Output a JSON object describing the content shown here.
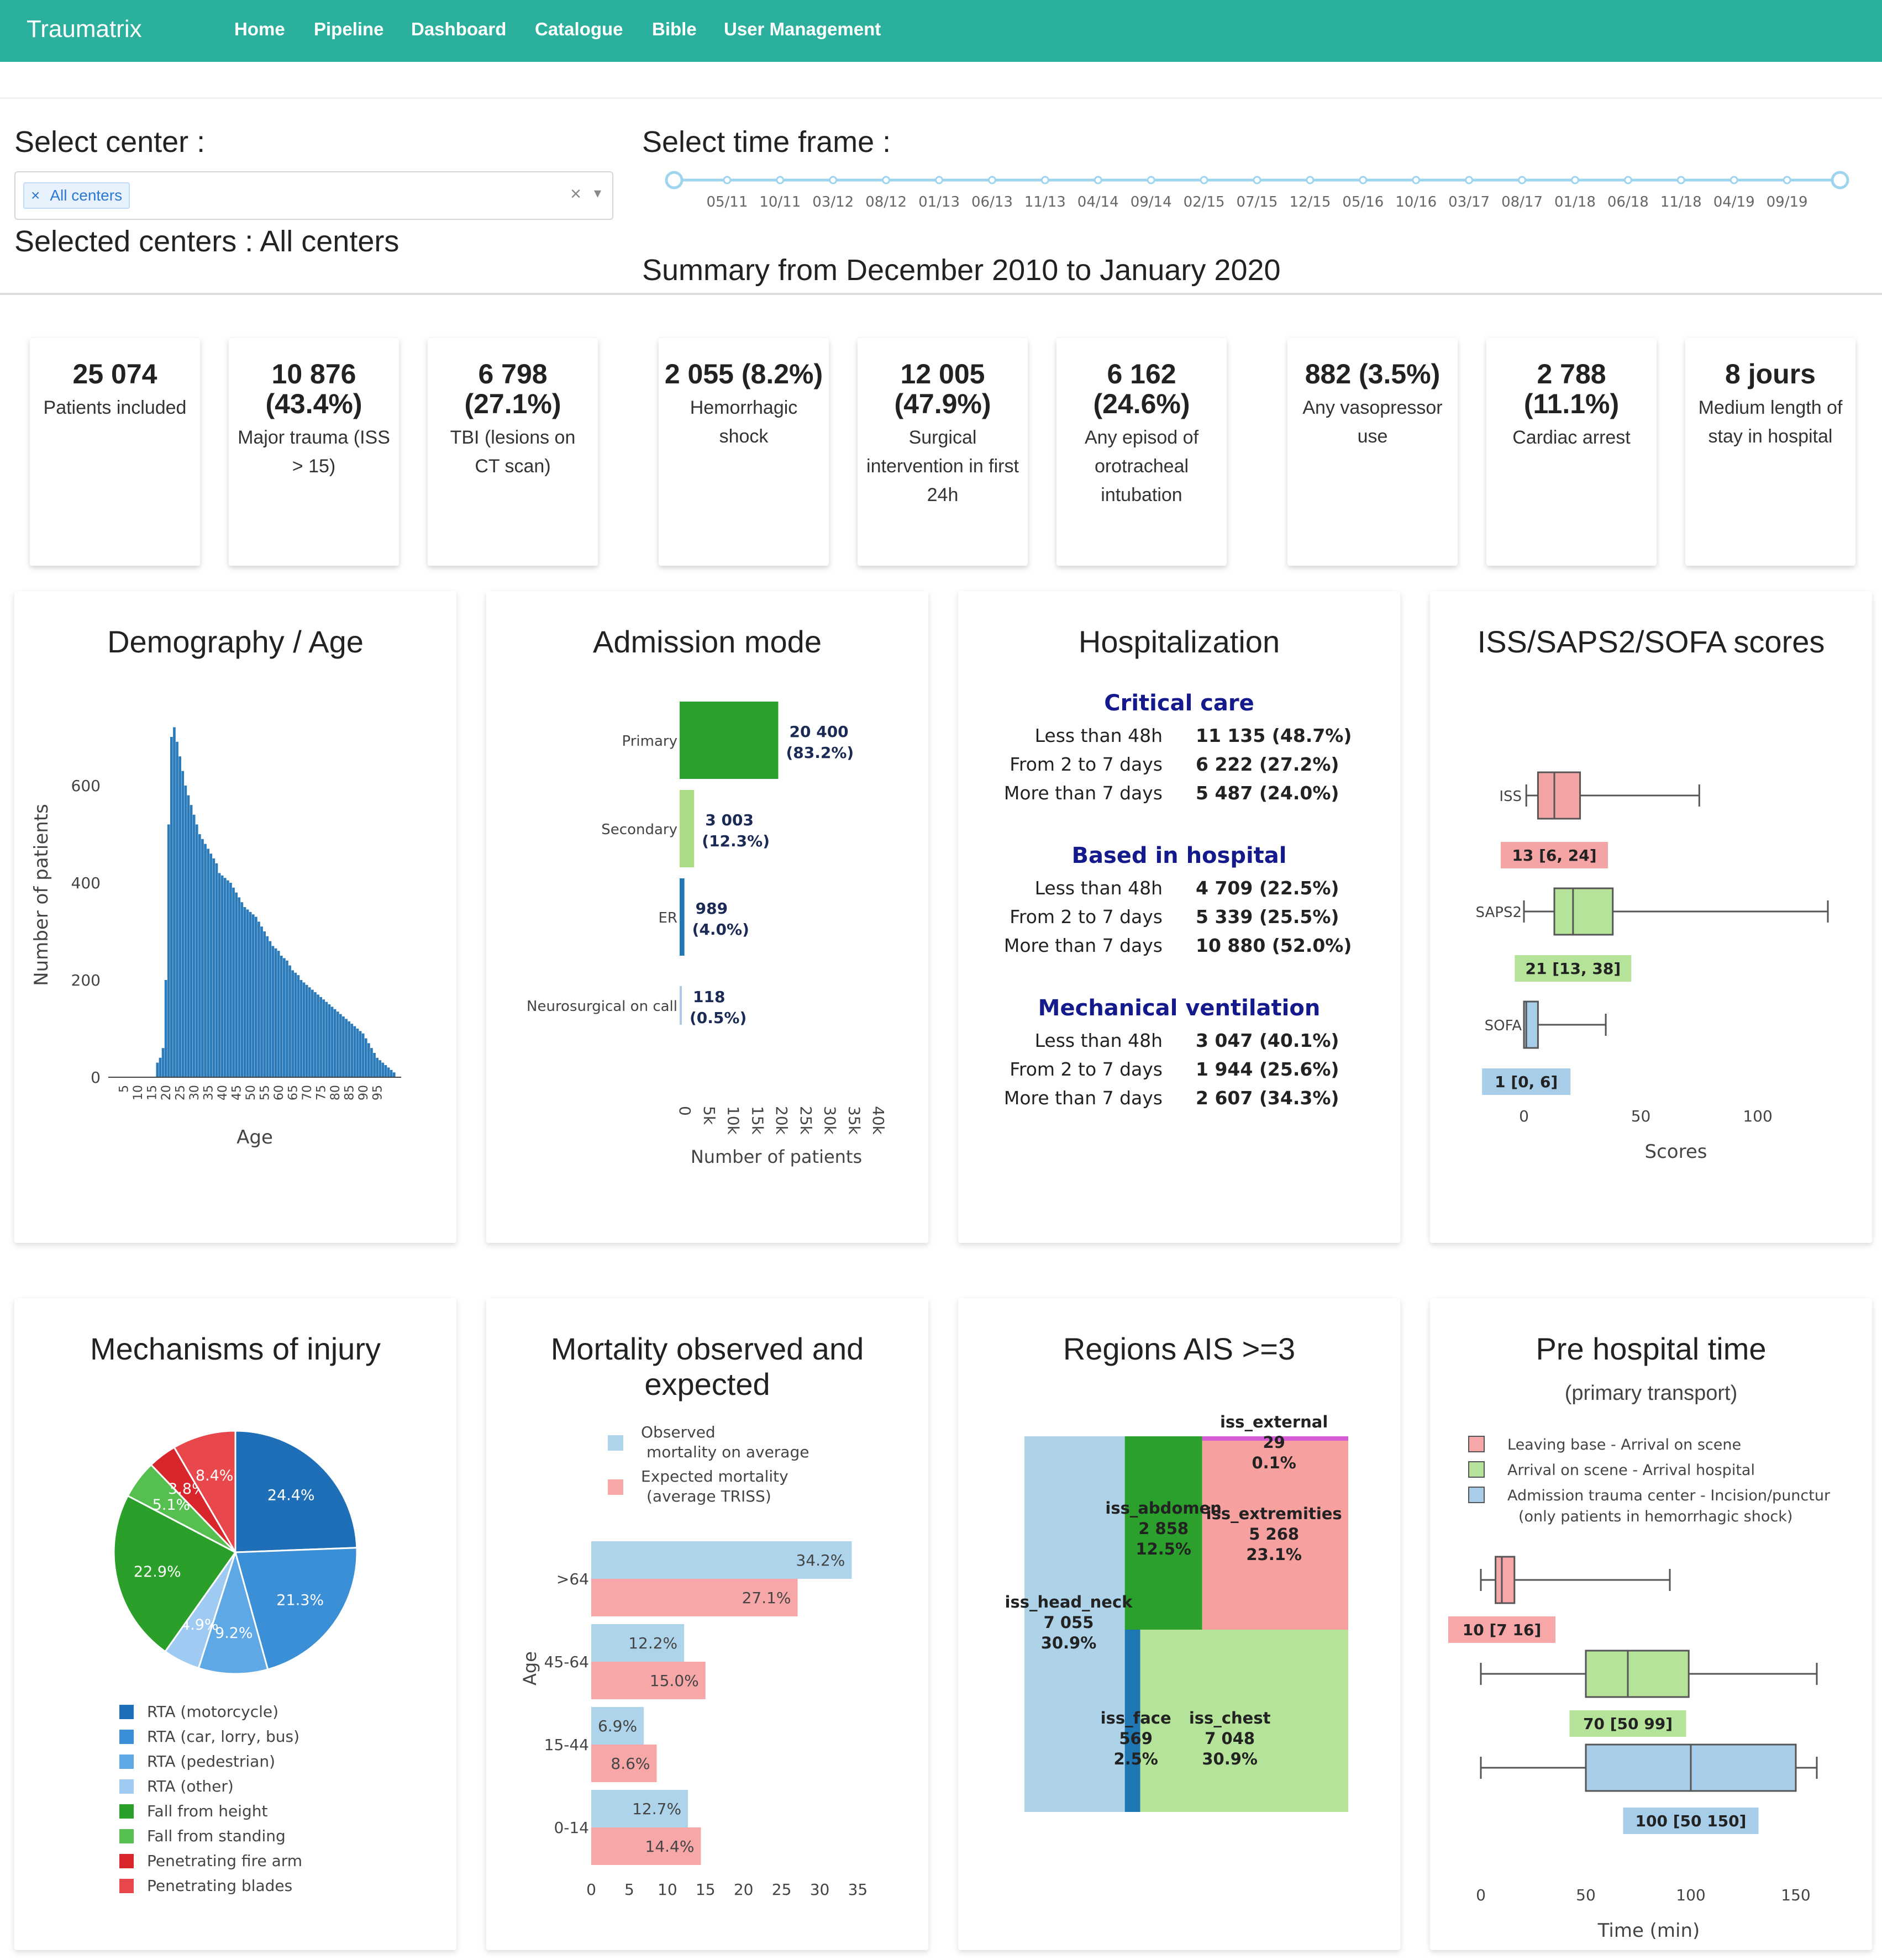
{
  "navbar": {
    "brand": "Traumatrix",
    "items": [
      "Home",
      "Pipeline",
      "Dashboard",
      "Catalogue",
      "Bible",
      "User Management"
    ]
  },
  "filters": {
    "center_label": "Select center :",
    "center_tag": "All centers",
    "clear_icon": "×",
    "dropdown_icon": "chevron-down-icon",
    "selected_text": "Selected centers : All centers",
    "time_label": "Select time frame :",
    "time_ticks": [
      "05/11",
      "10/11",
      "03/12",
      "08/12",
      "01/13",
      "06/13",
      "11/13",
      "04/14",
      "09/14",
      "02/15",
      "07/15",
      "12/15",
      "05/16",
      "10/16",
      "03/17",
      "08/17",
      "01/18",
      "06/18",
      "11/18",
      "04/19",
      "09/19"
    ],
    "summary": "Summary from December 2010 to January 2020"
  },
  "stats": [
    {
      "value": "25 074",
      "label": "Patients included"
    },
    {
      "value": "10 876 (43.4%)",
      "label": "Major trauma (ISS > 15)"
    },
    {
      "value": "6 798 (27.1%)",
      "label": "TBI (lesions on CT scan)"
    },
    {
      "value": "2 055 (8.2%)",
      "label": "Hemorrhagic shock"
    },
    {
      "value": "12 005 (47.9%)",
      "label": "Surgical intervention in first 24h"
    },
    {
      "value": "6 162 (24.6%)",
      "label": "Any episod of orotracheal intubation"
    },
    {
      "value": "882 (3.5%)",
      "label": "Any vasopressor use"
    },
    {
      "value": "2 788 (11.1%)",
      "label": "Cardiac arrest"
    },
    {
      "value": "8 jours",
      "label": "Medium length of stay in hospital"
    }
  ],
  "panels": {
    "demography": {
      "title": "Demography / Age"
    },
    "admission": {
      "title": "Admission mode"
    },
    "hospitalization": {
      "title": "Hospitalization",
      "sections": [
        {
          "heading": "Critical care",
          "rows": [
            [
              "Less than 48h",
              "11 135 (48.7%)"
            ],
            [
              "From 2 to 7 days",
              "6 222 (27.2%)"
            ],
            [
              "More than 7 days",
              "5 487 (24.0%)"
            ]
          ]
        },
        {
          "heading": "Based in hospital",
          "rows": [
            [
              "Less than 48h",
              "4 709 (22.5%)"
            ],
            [
              "From 2 to 7 days",
              "5 339 (25.5%)"
            ],
            [
              "More than 7 days",
              "10 880 (52.0%)"
            ]
          ]
        },
        {
          "heading": "Mechanical ventilation",
          "rows": [
            [
              "Less than 48h",
              "3 047 (40.1%)"
            ],
            [
              "From 2 to 7 days",
              "1 944 (25.6%)"
            ],
            [
              "More than 7 days",
              "2 607 (34.3%)"
            ]
          ]
        }
      ]
    },
    "scores": {
      "title": "ISS/SAPS2/SOFA scores"
    },
    "mechanisms": {
      "title": "Mechanisms of injury"
    },
    "mortality": {
      "title": "Mortality observed and expected"
    },
    "regions": {
      "title": "Regions AIS >=3"
    },
    "prehospital": {
      "title": "Pre hospital time",
      "subtitle": "(primary transport)"
    }
  },
  "chart_data": [
    {
      "type": "bar",
      "name": "age_histogram",
      "xlabel": "Age",
      "ylabel": "Number of patients",
      "yticks": [
        0,
        200,
        400,
        600
      ],
      "ylim": [
        0,
        750
      ],
      "x": [
        15,
        16,
        17,
        18,
        19,
        20,
        21,
        22,
        23,
        24,
        25,
        26,
        27,
        28,
        29,
        30,
        31,
        32,
        33,
        34,
        35,
        36,
        37,
        38,
        39,
        40,
        41,
        42,
        43,
        44,
        45,
        46,
        47,
        48,
        49,
        50,
        51,
        52,
        53,
        54,
        55,
        56,
        57,
        58,
        59,
        60,
        61,
        62,
        63,
        64,
        65,
        66,
        67,
        68,
        69,
        70,
        71,
        72,
        73,
        74,
        75,
        76,
        77,
        78,
        79,
        80,
        81,
        82,
        83,
        84,
        85,
        86,
        87,
        88,
        89,
        90,
        91,
        92,
        93,
        94,
        95,
        96,
        97,
        98,
        99
      ],
      "values": [
        30,
        40,
        60,
        200,
        520,
        700,
        720,
        690,
        660,
        630,
        600,
        580,
        560,
        540,
        520,
        500,
        490,
        480,
        470,
        460,
        450,
        440,
        420,
        415,
        410,
        405,
        400,
        390,
        380,
        370,
        360,
        350,
        345,
        340,
        335,
        330,
        320,
        310,
        300,
        290,
        280,
        270,
        265,
        260,
        250,
        245,
        240,
        230,
        220,
        215,
        210,
        200,
        195,
        190,
        185,
        180,
        175,
        170,
        165,
        160,
        155,
        150,
        145,
        140,
        135,
        130,
        125,
        120,
        115,
        110,
        105,
        100,
        95,
        90,
        80,
        70,
        60,
        50,
        40,
        35,
        30,
        25,
        20,
        15,
        10
      ]
    },
    {
      "type": "bar",
      "name": "admission_mode",
      "orientation": "horizontal",
      "categories": [
        "Primary",
        "Secondary",
        "ER",
        "Neurosurgical on call"
      ],
      "values": [
        20400,
        3003,
        989,
        118
      ],
      "labels": [
        "20 400 (83.2%)",
        "3 003 (12.3%)",
        "989 (4.0%)",
        "118 (0.5%)"
      ],
      "colors": [
        "#2ca02c",
        "#a9dc84",
        "#1f77b4",
        "#aec7e8"
      ],
      "xlabel": "Number of patients",
      "xticks": [
        "0",
        "5k",
        "10k",
        "15k",
        "20k",
        "25k",
        "30k",
        "35k",
        "40k"
      ],
      "xlim": [
        0,
        40000
      ]
    },
    {
      "type": "box",
      "name": "scores",
      "xlabel": "Scores",
      "xticks": [
        0,
        50,
        100
      ],
      "xlim": [
        0,
        130
      ],
      "series": [
        {
          "name": "ISS",
          "q1": 6,
          "median": 13,
          "q3": 24,
          "whisker_low": 1,
          "whisker_high": 75,
          "label": "13 [6, 24]",
          "color": "#f4a4a4"
        },
        {
          "name": "SAPS2",
          "q1": 13,
          "median": 21,
          "q3": 38,
          "whisker_low": 0,
          "whisker_high": 130,
          "label": "21 [13, 38]",
          "color": "#b5e39a"
        },
        {
          "name": "SOFA",
          "q1": 0,
          "median": 1,
          "q3": 6,
          "whisker_low": 0,
          "whisker_high": 35,
          "label": "1 [0, 6]",
          "color": "#a8cde8"
        }
      ]
    },
    {
      "type": "pie",
      "name": "mechanisms",
      "categories": [
        "RTA (motorcycle)",
        "RTA (car, lorry, bus)",
        "RTA (pedestrian)",
        "RTA (other)",
        "Fall from height",
        "Fall from standing",
        "Penetrating fire arm",
        "Penetrating blades"
      ],
      "values": [
        24.4,
        21.3,
        9.2,
        4.9,
        22.9,
        5.1,
        3.8,
        8.4
      ],
      "colors": [
        "#1f6fb8",
        "#3a8fd6",
        "#5fa8e6",
        "#9fcbf2",
        "#2aa02b",
        "#55bf4f",
        "#d9262c",
        "#e8474c"
      ]
    },
    {
      "type": "bar",
      "name": "mortality",
      "orientation": "horizontal",
      "ylabel": "Age",
      "categories": [
        ">64",
        "45-64",
        "15-44",
        "0-14"
      ],
      "xticks": [
        0,
        5,
        10,
        15,
        20,
        25,
        30,
        35
      ],
      "xlim": [
        0,
        37
      ],
      "series": [
        {
          "name": "Observed mortality on average",
          "values": [
            34.2,
            12.2,
            6.9,
            12.7
          ],
          "color": "#add4ea"
        },
        {
          "name": "Expected mortality (average TRISS)",
          "values": [
            27.1,
            15.0,
            8.6,
            14.4
          ],
          "color": "#f7a7a7"
        }
      ]
    },
    {
      "type": "treemap",
      "name": "regions",
      "items": [
        {
          "name": "iss_head_neck",
          "value": "7 055",
          "pct": "30.9%",
          "color": "#aed3e9"
        },
        {
          "name": "iss_face",
          "value": "569",
          "pct": "2.5%",
          "color": "#1f77b4"
        },
        {
          "name": "iss_abdomen",
          "value": "2 858",
          "pct": "12.5%",
          "color": "#2ca02c"
        },
        {
          "name": "iss_extremities",
          "value": "5 268",
          "pct": "23.1%",
          "color": "#f7a0a0"
        },
        {
          "name": "iss_chest",
          "value": "7 048",
          "pct": "30.9%",
          "color": "#b5e39a"
        },
        {
          "name": "iss_external",
          "value": "29",
          "pct": "0.1%",
          "color": "#d35bd3"
        }
      ]
    },
    {
      "type": "box",
      "name": "prehospital",
      "xlabel": "Time (min)",
      "xticks": [
        0,
        50,
        100,
        150
      ],
      "xlim": [
        0,
        160
      ],
      "series": [
        {
          "name": "Leaving base - Arrival on scene",
          "q1": 7,
          "median": 10,
          "q3": 16,
          "whisker_low": 0,
          "whisker_high": 90,
          "label": "10 [7  16]",
          "color": "#f7a7a7"
        },
        {
          "name": "Arrival on scene - Arrival hospital",
          "q1": 50,
          "median": 70,
          "q3": 99,
          "whisker_low": 0,
          "whisker_high": 160,
          "label": "70 [50  99]",
          "color": "#b5e39a"
        },
        {
          "name": "Admission trauma center - Incision/punctur (only patients in hemorrhagic shock)",
          "q1": 50,
          "median": 100,
          "q3": 150,
          "whisker_low": 0,
          "whisker_high": 160,
          "label": "100 [50  150]",
          "color": "#a8cde8"
        }
      ]
    }
  ]
}
